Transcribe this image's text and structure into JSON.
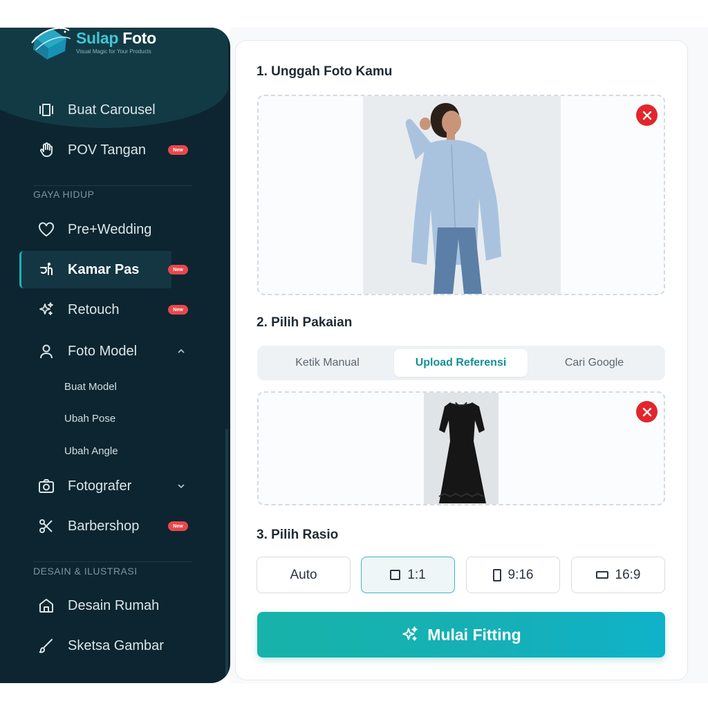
{
  "brand": {
    "name_part1": "Sulap",
    "name_part2": " Foto",
    "tagline": "Visual Magic for Your Products",
    "accent_color": "#3fc6d6"
  },
  "sidebar": {
    "items": [
      {
        "label": "Buat Carousel",
        "icon": "carousel-icon"
      },
      {
        "label": "POV Tangan",
        "icon": "hand-icon",
        "badge": "New"
      },
      {
        "label": "Pre+Wedding",
        "icon": "heart-icon"
      },
      {
        "label": "Kamar Pas",
        "icon": "fitting-icon",
        "badge": "New",
        "active": true
      },
      {
        "label": "Retouch",
        "icon": "sparkle-icon",
        "badge": "New"
      },
      {
        "label": "Foto Model",
        "icon": "user-icon",
        "expanded": true
      },
      {
        "label": "Fotografer",
        "icon": "camera-icon"
      },
      {
        "label": "Barbershop",
        "icon": "scissors-icon",
        "badge": "New"
      },
      {
        "label": "Desain Rumah",
        "icon": "home-icon"
      },
      {
        "label": "Sketsa Gambar",
        "icon": "brush-icon"
      }
    ],
    "sections": {
      "lifestyle": "GAYA HIDUP",
      "design": "DESAIN & ILUSTRASI"
    },
    "sub_items": [
      "Buat Model",
      "Ubah Pose",
      "Ubah Angle"
    ],
    "badge_label": "New",
    "badge_color": "#e8484b",
    "active_color": "#19b3b8"
  },
  "main": {
    "step1": "1. Unggah Foto Kamu",
    "step2": "2. Pilih Pakaian",
    "step3": "3. Pilih Rasio",
    "tabs": [
      {
        "label": "Ketik Manual",
        "selected": false
      },
      {
        "label": "Upload Referensi",
        "selected": true
      },
      {
        "label": "Cari Google",
        "selected": false
      }
    ],
    "ratios": [
      {
        "label": "Auto",
        "selected": false
      },
      {
        "label": "1:1",
        "selected": true,
        "icon": "square-icon"
      },
      {
        "label": "9:16",
        "selected": false,
        "icon": "portrait-icon"
      },
      {
        "label": "16:9",
        "selected": false,
        "icon": "landscape-icon"
      }
    ],
    "cta_label": "Mulai Fitting",
    "cta_icon": "sparkle-icon",
    "remove_color": "#e2262c"
  }
}
